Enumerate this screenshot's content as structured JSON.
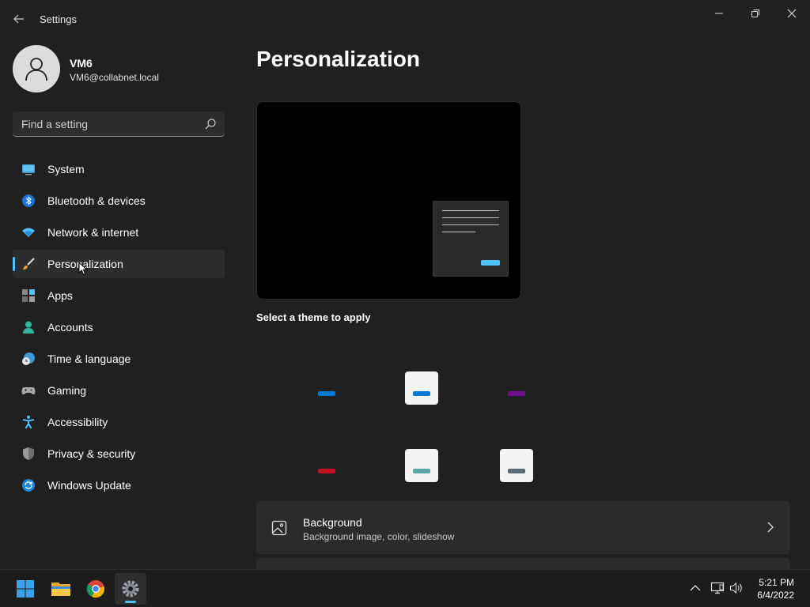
{
  "window": {
    "title": "Settings",
    "controls": [
      "minimize",
      "maximize",
      "close"
    ]
  },
  "profile": {
    "name": "VM6",
    "email": "VM6@collabnet.local"
  },
  "search": {
    "placeholder": "Find a setting"
  },
  "sidebar": {
    "selected": "Personalization",
    "items": [
      {
        "label": "System",
        "icon": "system-icon"
      },
      {
        "label": "Bluetooth & devices",
        "icon": "bluetooth-icon"
      },
      {
        "label": "Network & internet",
        "icon": "network-icon"
      },
      {
        "label": "Personalization",
        "icon": "brush-icon"
      },
      {
        "label": "Apps",
        "icon": "apps-icon"
      },
      {
        "label": "Accounts",
        "icon": "accounts-icon"
      },
      {
        "label": "Time & language",
        "icon": "time-language-icon"
      },
      {
        "label": "Gaming",
        "icon": "gaming-icon"
      },
      {
        "label": "Accessibility",
        "icon": "accessibility-icon"
      },
      {
        "label": "Privacy & security",
        "icon": "shield-icon"
      },
      {
        "label": "Windows Update",
        "icon": "update-icon"
      }
    ]
  },
  "main": {
    "title": "Personalization",
    "theme_heading": "Select a theme to apply",
    "themes": [
      {
        "background": "#202020",
        "accent": "#0078d4"
      },
      {
        "background": "#f3f3f3",
        "accent": "#0078d4"
      },
      {
        "background": "#202020",
        "accent": "#6b0f8f"
      },
      {
        "background": "#202020",
        "accent": "#c50f1f"
      },
      {
        "background": "#f3f3f3",
        "accent": "#5aa5a5"
      },
      {
        "background": "#f3f3f3",
        "accent": "#5a6a72"
      }
    ],
    "cards": [
      {
        "title": "Background",
        "subtitle": "Background image, color, slideshow",
        "icon": "image-icon"
      }
    ]
  },
  "taskbar": {
    "apps": [
      "start-icon",
      "file-explorer-icon",
      "chrome-icon",
      "settings-icon"
    ],
    "tray": [
      "chevron-up-icon",
      "network-icon",
      "volume-icon"
    ],
    "time": "5:21 PM",
    "date": "6/4/2022"
  },
  "colors": {
    "accent": "#4cc2ff",
    "background": "#202020",
    "card": "#2b2b2b"
  }
}
